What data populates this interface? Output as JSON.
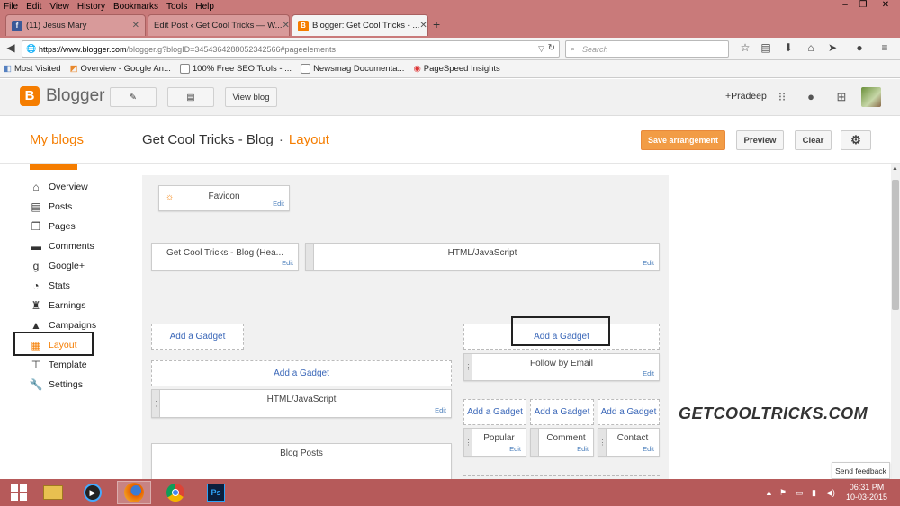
{
  "menubar": [
    "File",
    "Edit",
    "View",
    "History",
    "Bookmarks",
    "Tools",
    "Help"
  ],
  "tabs": [
    {
      "title": "(11) Jesus Mary",
      "close": "✕"
    },
    {
      "title": "Edit Post ‹ Get Cool Tricks — W...",
      "close": "✕"
    },
    {
      "title": "Blogger: Get Cool Tricks - ...",
      "close": "✕"
    }
  ],
  "new_tab": "+",
  "url": {
    "domain": "https://www.blogger.com",
    "path": "/blogger.g?blogID=3454364288052342566#pageelements"
  },
  "search": {
    "placeholder": "Search"
  },
  "bookmarks": [
    "Most Visited",
    "Overview - Google An...",
    "100% Free SEO Tools - ...",
    "Newsmag Documenta...",
    "PageSpeed Insights"
  ],
  "blogger": {
    "logo_letter": "B",
    "logo_text": "Blogger",
    "view_blog": "View blog",
    "user": "+Pradeep"
  },
  "subheader": {
    "my_blogs": "My blogs",
    "blog_name": "Get Cool Tricks - Blog",
    "separator": "·",
    "page": "Layout",
    "save": "Save arrangement",
    "preview": "Preview",
    "clear": "Clear"
  },
  "sidebar": [
    {
      "label": "Overview",
      "icon": "home-icon"
    },
    {
      "label": "Posts",
      "icon": "posts-icon"
    },
    {
      "label": "Pages",
      "icon": "pages-icon"
    },
    {
      "label": "Comments",
      "icon": "comments-icon"
    },
    {
      "label": "Google+",
      "icon": "google-plus-icon"
    },
    {
      "label": "Stats",
      "icon": "stats-icon"
    },
    {
      "label": "Earnings",
      "icon": "trophy-icon"
    },
    {
      "label": "Campaigns",
      "icon": "campaigns-icon"
    },
    {
      "label": "Layout",
      "icon": "layout-icon",
      "active": true
    },
    {
      "label": "Template",
      "icon": "template-icon"
    },
    {
      "label": "Settings",
      "icon": "wrench-icon"
    }
  ],
  "layout": {
    "favicon": {
      "title": "Favicon",
      "edit": "Edit"
    },
    "header": {
      "title": "Get Cool Tricks - Blog (Hea...",
      "edit": "Edit"
    },
    "header_html": {
      "title": "HTML/JavaScript",
      "edit": "Edit"
    },
    "add_gadget": "Add a Gadget",
    "follow_email": {
      "title": "Follow by Email",
      "edit": "Edit"
    },
    "main_html": {
      "title": "HTML/JavaScript",
      "edit": "Edit"
    },
    "popular": {
      "title": "Popular",
      "edit": "Edit"
    },
    "comment": {
      "title": "Comment",
      "edit": "Edit"
    },
    "contact": {
      "title": "Contact",
      "edit": "Edit"
    },
    "blog_posts": {
      "title": "Blog Posts"
    }
  },
  "watermark": "GETCOOLTRICKS.COM",
  "feedback": "Send feedback",
  "clock": {
    "time": "06:31 PM",
    "date": "10-03-2015"
  },
  "colors": {
    "accent": "#f57d00",
    "titlebar": "#c97a7a",
    "taskbar": "#b65a5a",
    "link": "#3a67b8"
  }
}
